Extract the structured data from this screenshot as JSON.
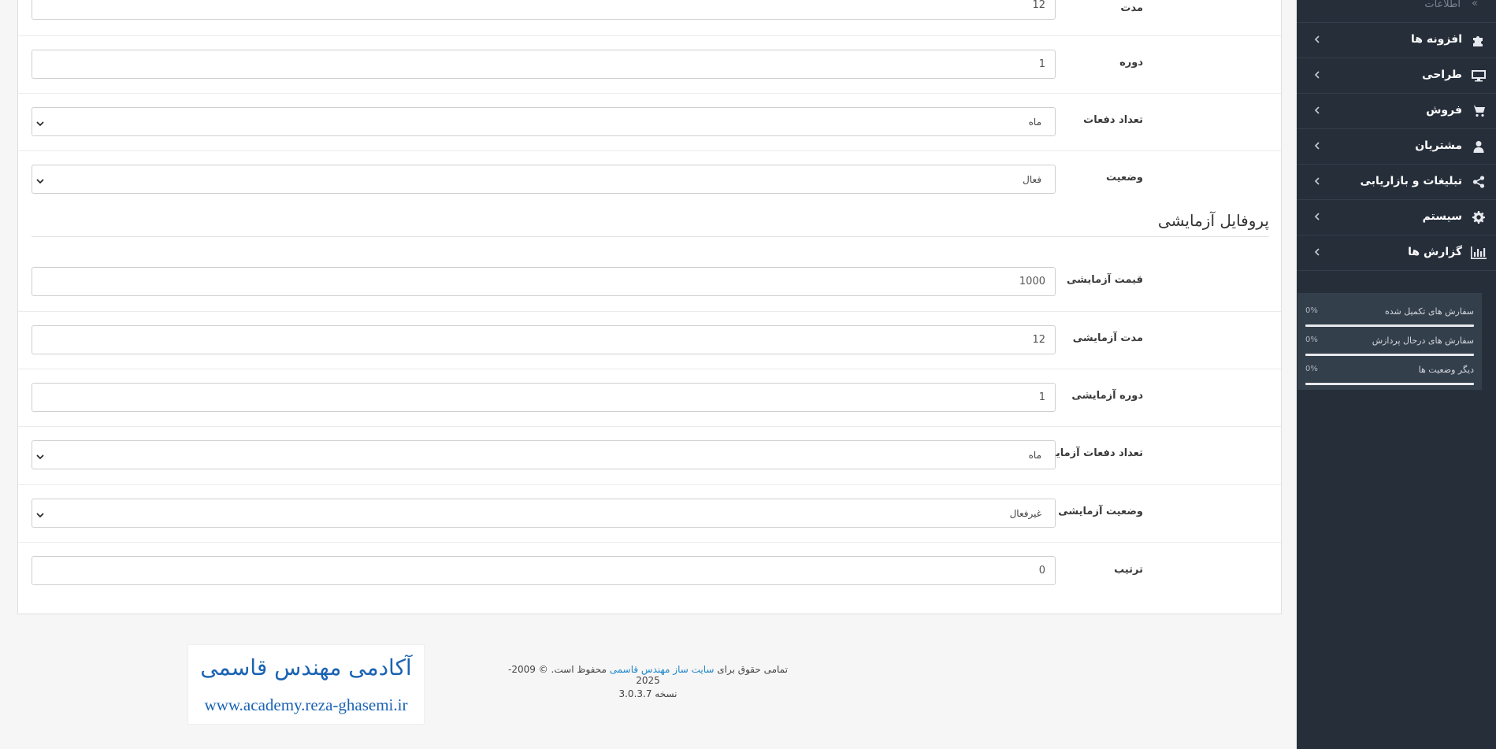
{
  "sidebar": {
    "top_item": {
      "label": "اطلاعات",
      "icon": "double-chevron-icon"
    },
    "items": [
      {
        "label": "افزونه ها",
        "icon": "puzzle-icon"
      },
      {
        "label": "طراحی",
        "icon": "monitor-icon"
      },
      {
        "label": "فروش",
        "icon": "cart-icon"
      },
      {
        "label": "مشتریان",
        "icon": "user-icon"
      },
      {
        "label": "تبلیغات و بازاریابی",
        "icon": "share-icon"
      },
      {
        "label": "سیستم",
        "icon": "gear-icon"
      },
      {
        "label": "گزارش ها",
        "icon": "bar-chart-icon"
      }
    ],
    "stats": [
      {
        "label": "سفارش های تکمیل شده",
        "value": "0%",
        "progress": 0
      },
      {
        "label": "سفارش های درحال پردازش",
        "value": "0%",
        "progress": 0
      },
      {
        "label": "دیگر وضعیت ها",
        "value": "0%",
        "progress": 0
      }
    ]
  },
  "form": {
    "duration": {
      "label": "مدت",
      "value": "12"
    },
    "cycle": {
      "label": "دوره",
      "value": "1"
    },
    "frequency": {
      "label": "تعداد دفعات",
      "value": "ماه"
    },
    "status": {
      "label": "وضعیت",
      "value": "فعال"
    },
    "trial_section_title": "پروفایل آزمایشی",
    "trial_price": {
      "label": "قیمت آزمایشی",
      "value": "1000"
    },
    "trial_duration": {
      "label": "مدت آزمایشی",
      "value": "12"
    },
    "trial_cycle": {
      "label": "دوره آزمایشی",
      "value": "1"
    },
    "trial_frequency": {
      "label": "تعداد دفعات آزمایشی",
      "value": "ماه"
    },
    "trial_status": {
      "label": "وضعیت آزمایشی",
      "value": "غیرفعال"
    },
    "sort_order": {
      "label": "ترتیب",
      "value": "0"
    }
  },
  "footer": {
    "prefix": "تمامی حقوق برای",
    "link_text": "سایت ساز مهندس قاسمی",
    "suffix": "محفوظ است. © 2009-2025",
    "version": "نسخه 3.0.3.7"
  },
  "brand": {
    "title": "آکادمی مهندس قاسمی",
    "url": "www.academy.reza-ghasemi.ir"
  },
  "colors": {
    "sidebar_bg": "#262e3a",
    "link": "#1f87c9",
    "brand_text": "#1a63b3"
  }
}
